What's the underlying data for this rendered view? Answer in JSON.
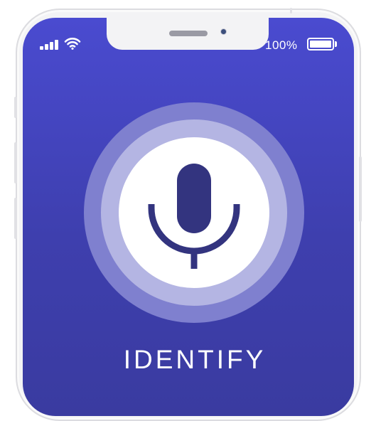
{
  "status_bar": {
    "battery_percent": "100%",
    "signal_icon": "cellular-signal-icon",
    "wifi_icon": "wifi-icon",
    "battery_icon": "battery-icon",
    "battery_level": 1.0
  },
  "main": {
    "mic_icon": "microphone-icon",
    "action_label": "IDENTIFY"
  },
  "colors": {
    "screen_top": "#4a4bd0",
    "screen_bottom": "#3a3ba0",
    "ring_outer": "#7f80cf",
    "ring_middle": "#b4b5e3",
    "ring_inner": "#ffffff",
    "mic": "#33347f"
  }
}
